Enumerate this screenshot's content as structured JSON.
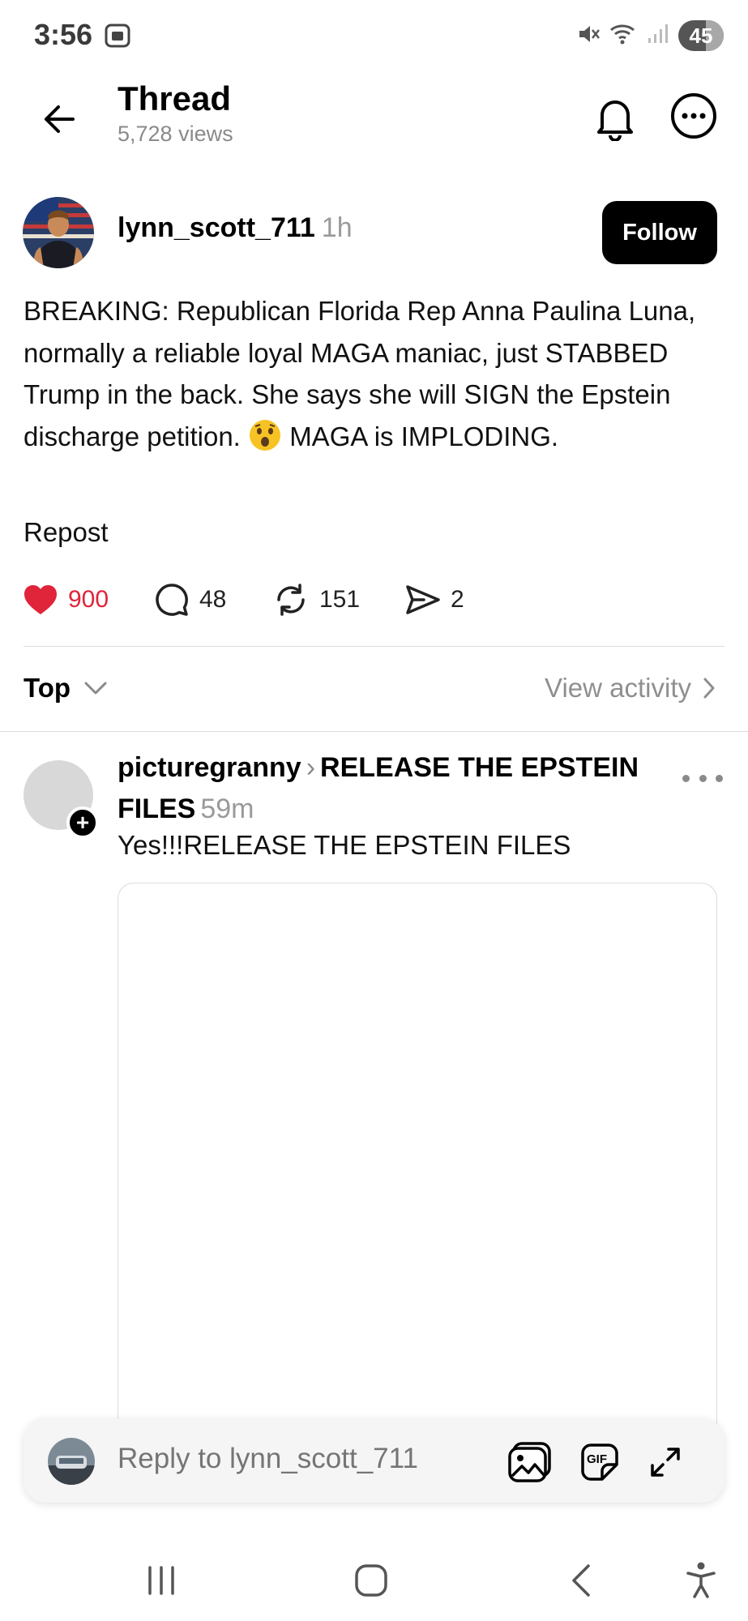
{
  "status_bar": {
    "time": "3:56",
    "battery": "45"
  },
  "header": {
    "title": "Thread",
    "views": "5,728 views"
  },
  "post": {
    "username": "lynn_scott_711",
    "time": "1h",
    "follow_label": "Follow",
    "text_part1": "BREAKING: Republican Florida Rep Anna Paulina Luna, normally a reliable loyal MAGA maniac, just STABBED Trump in the back. She says she will SIGN the Epstein discharge petition.",
    "text_part2": "MAGA is IMPLODING.",
    "repost_label": "Repost",
    "likes": "900",
    "comments": "48",
    "reposts": "151",
    "shares": "2",
    "like_color": "#e0243a"
  },
  "sort": {
    "label": "Top",
    "view_activity": "View activity"
  },
  "reply": {
    "username": "picturegranny",
    "topic": "RELEASE THE EPSTEIN FILES",
    "time": "59m",
    "text": "Yes!!!RELEASE THE EPSTEIN FILES"
  },
  "composer": {
    "placeholder": "Reply to lynn_scott_711"
  }
}
